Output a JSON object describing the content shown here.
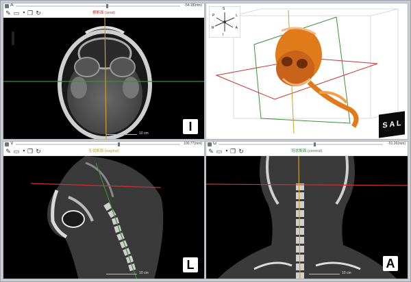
{
  "panes": {
    "axial": {
      "axis_letter": "A",
      "value": "-54.18(mm)",
      "title": "横断面 (axial)",
      "title_color": "#d13030",
      "orient": "I",
      "scale": "10 cm"
    },
    "volume": {
      "cube_letters": "S A L",
      "compass": [
        "S",
        "P",
        "L",
        "R",
        "I",
        "A"
      ]
    },
    "sagittal": {
      "axis_letter": "V",
      "value": "100.77(mm)",
      "title": "矢状断面 (sagittal)",
      "title_color": "#c9a227",
      "orient": "L",
      "scale": "10 cm"
    },
    "coronal": {
      "axis_letter": "G",
      "value": "-51.26(mm)",
      "title": "冠状断面 (coronal)",
      "title_color": "#2f8f2f",
      "orient": "A",
      "scale": "10 cm"
    }
  },
  "toolbar_icons": [
    "pencil-icon",
    "clipboard-icon",
    "dropdown-icon",
    "layers-icon",
    "reset-icon"
  ],
  "colors": {
    "axial_line": "#c33",
    "sagittal_line": "#c9a227",
    "coronal_line": "#3a8f3a",
    "bone": "#d9d9d9",
    "volume": "#e07a1a"
  },
  "sliders": {
    "axial": 0.55,
    "sagittal": 0.62,
    "coronal": 0.58
  }
}
